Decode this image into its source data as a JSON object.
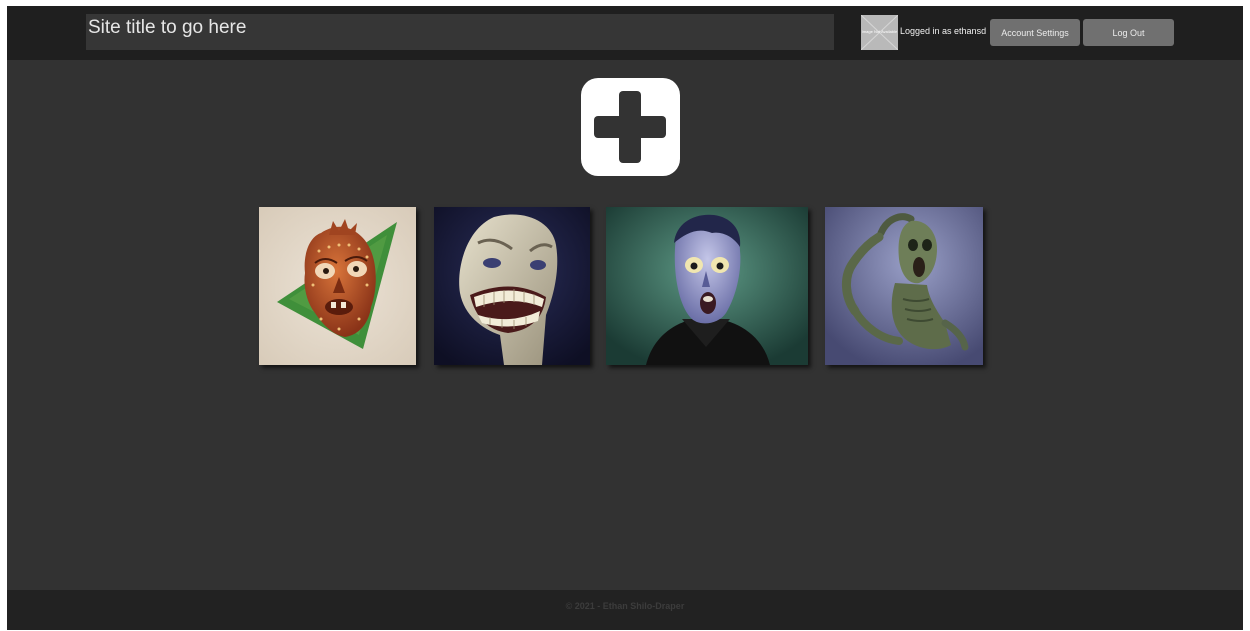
{
  "header": {
    "site_title": "Site title to go here",
    "avatar_placeholder_text": "Image Not Available",
    "logged_in_text": "Logged in as ethansd",
    "account_settings_label": "Account Settings",
    "logout_label": "Log Out"
  },
  "main": {
    "add_icon": "plus-icon",
    "gallery": [
      {
        "subject": "orange-masked-face-on-green-triangle"
      },
      {
        "subject": "grimacing-pale-face"
      },
      {
        "subject": "blue-screaming-zombie-in-black-coat"
      },
      {
        "subject": "green-figure-clutching-head"
      }
    ]
  },
  "footer": {
    "text": "© 2021 - Ethan Shilo-Draper"
  },
  "colors": {
    "page_background": "#323232",
    "topbar_background": "#1f1f1f",
    "button_background": "#707070",
    "footer_background": "#222222",
    "add_button_background": "#ffffff"
  }
}
